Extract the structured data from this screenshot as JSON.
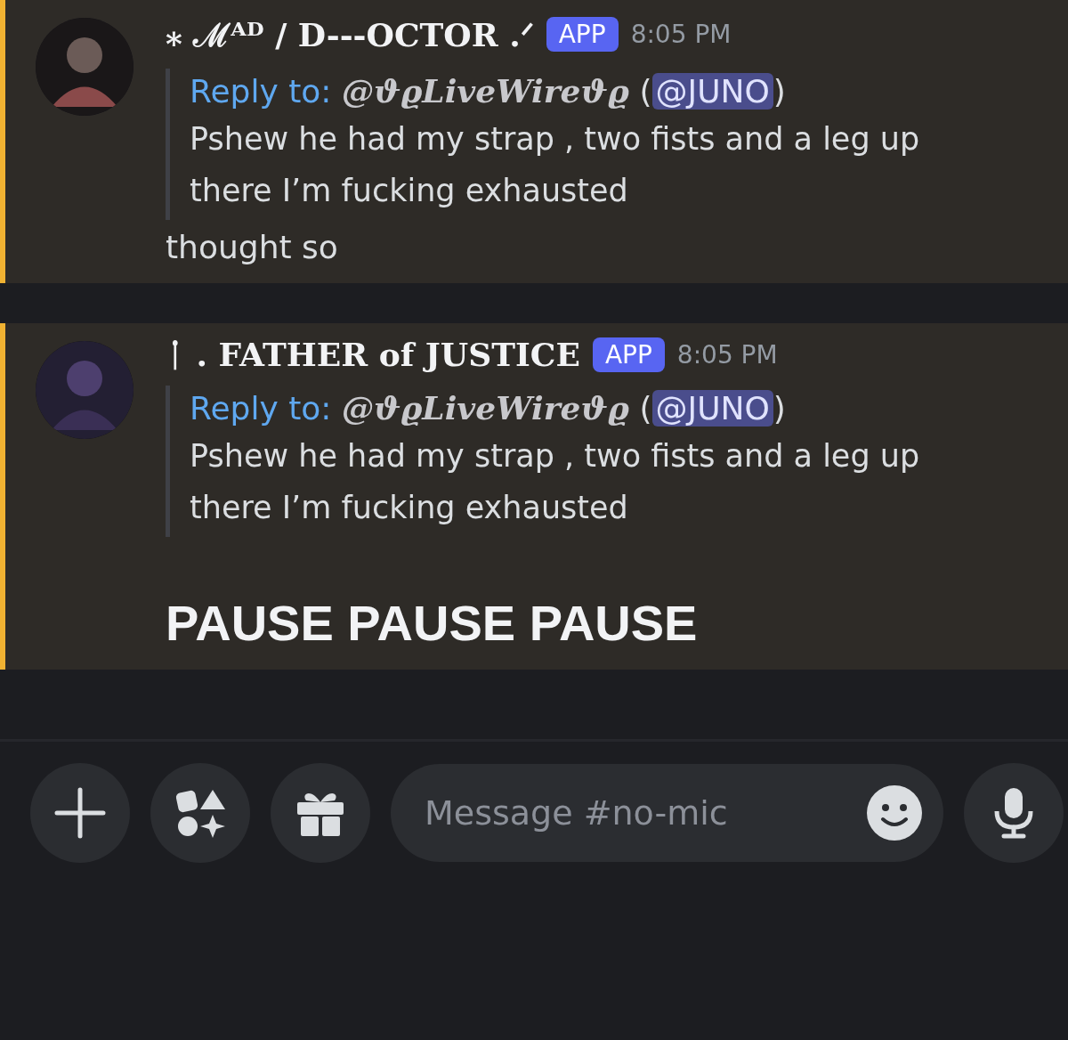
{
  "messages": [
    {
      "author": "⁎  ℳᴬᴰ  /  D---OCTOR .ᐟ",
      "badge": "APP",
      "time": "8:05 PM",
      "highlighted": true,
      "reply": {
        "label": "Reply to:",
        "user": "@ϑϱLiveWireϑϱ",
        "open": "(",
        "mention": "@JUNO",
        "close": ")",
        "text": "Pshew he had my strap , two fists and a leg up there I’m fucking exhausted"
      },
      "lines": [
        {
          "kind": "text",
          "text": "thought so"
        }
      ]
    },
    {
      "author": "ᛙ . FATHER of JUSTICE",
      "badge": "APP",
      "time": "8:05 PM",
      "highlighted": true,
      "reply": {
        "label": "Reply to:",
        "user": "@ϑϱLiveWireϑϱ",
        "open": "(",
        "mention": "@JUNO",
        "close": ")",
        "text": "Pshew he had my strap , two fists and a leg up there I’m fucking exhausted"
      },
      "lines": [
        {
          "kind": "heading",
          "text": "PAUSE PAUSE PAUSE"
        }
      ]
    }
  ],
  "composer": {
    "placeholder": "Message #no-mic"
  }
}
